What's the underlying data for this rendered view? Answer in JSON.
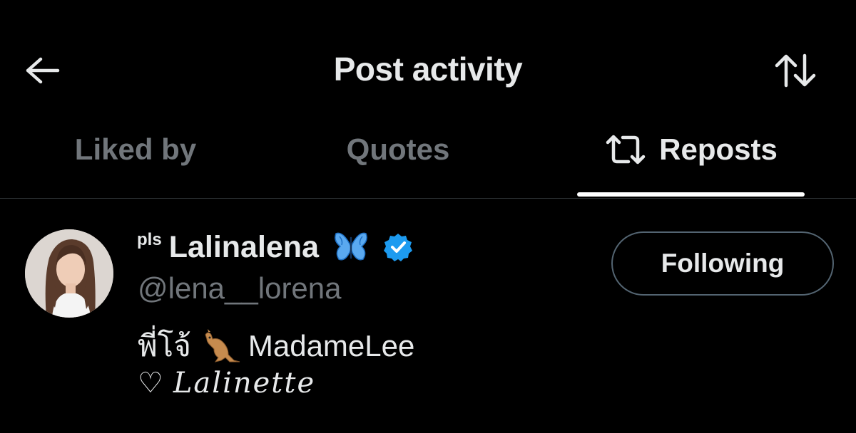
{
  "header": {
    "title": "Post activity",
    "back_icon": "arrow-left-icon",
    "sort_icon": "sort-arrows-icon"
  },
  "tabs": [
    {
      "label": "Liked by",
      "active": false
    },
    {
      "label": "Quotes",
      "active": false
    },
    {
      "label": "Reposts",
      "active": true,
      "icon": "repost-icon"
    }
  ],
  "users": [
    {
      "name_prefix": "pls",
      "display_name": "Lalinalena",
      "name_emoji": "butterfly-icon",
      "verified": true,
      "handle": "@lena__lorena",
      "bio_line1_thai": "พี่โจ้",
      "bio_line1_emoji": "kangaroo-icon",
      "bio_line1_text": "MadameLee",
      "bio_line2_heart": "♡",
      "bio_line2_text": "Lalinette",
      "follow_button_label": "Following"
    }
  ],
  "colors": {
    "background": "#000000",
    "primary_text": "#e7e9ea",
    "secondary_text": "#71767b",
    "verified_blue": "#1d9bf0",
    "button_border": "#536471"
  }
}
